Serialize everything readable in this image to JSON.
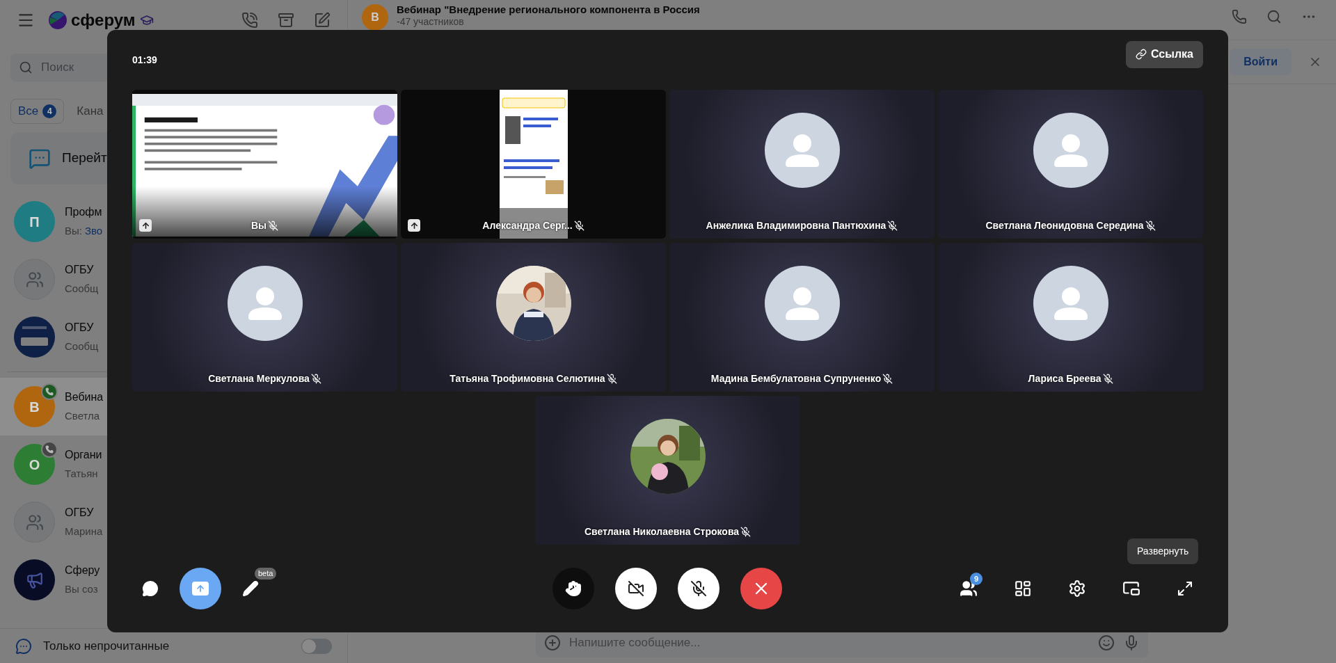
{
  "app_header": {
    "logo_text": "сферум"
  },
  "search": {
    "placeholder": "Поиск"
  },
  "filter_tabs": [
    {
      "label": "Все",
      "badge": "4",
      "selected": true
    },
    {
      "label": "Кана",
      "selected": false
    }
  ],
  "banner": {
    "text": "Перейт"
  },
  "chats": [
    {
      "title": "Профм",
      "preview": "Вы:",
      "link": "Зво",
      "avatar": {
        "kind": "letter",
        "letter": "П",
        "color": "#1f7c82"
      },
      "call_badge": false,
      "selected": false
    },
    {
      "title": "ОГБУ",
      "preview": "Сообщ",
      "avatar": {
        "kind": "group"
      },
      "call_badge": false,
      "selected": false
    },
    {
      "title": "ОГБУ",
      "preview": "Сообщ",
      "avatar": {
        "kind": "logo"
      },
      "call_badge": false,
      "selected": false
    },
    {
      "title": "Вебина",
      "preview": "Светла",
      "avatar": {
        "kind": "letter",
        "letter": "В",
        "color": "#b0650f"
      },
      "call_badge": true,
      "call_active": true,
      "selected": true
    },
    {
      "title": "Органи",
      "preview": "Татьян",
      "avatar": {
        "kind": "letter",
        "letter": "О",
        "color": "#2d7d35"
      },
      "call_badge": true,
      "call_active": false,
      "selected": false
    },
    {
      "title": "ОГБУ",
      "preview": "Марина",
      "avatar": {
        "kind": "group"
      },
      "call_badge": false,
      "selected": false
    },
    {
      "title": "Сферу",
      "preview": "Вы соз",
      "avatar": {
        "kind": "megaphone"
      },
      "call_badge": false,
      "selected": false
    }
  ],
  "unread_only": {
    "label": "Только непрочитанные",
    "on": false
  },
  "chat_header": {
    "avatar_letter": "В",
    "title": "Вебинар \"Внедрение регионального компонента в Россия",
    "subtitle": "-47 участников"
  },
  "join_bar": {
    "button": "Войти"
  },
  "composer": {
    "placeholder": "Напишите сообщение..."
  },
  "call": {
    "timer": "01:39",
    "link_button": "Ссылка",
    "tiles": [
      {
        "name": "Вы",
        "kind": "screen",
        "muted": true,
        "sharing": true
      },
      {
        "name": "Александра Серг...",
        "kind": "phone",
        "muted": true,
        "sharing": true
      },
      {
        "name": "Анжелика Владимировна Пантюхина",
        "kind": "avatar",
        "muted": true,
        "sharing": false
      },
      {
        "name": "Светлана Леонидовна Середина",
        "kind": "avatar",
        "muted": true,
        "sharing": false
      },
      {
        "name": "Светлана Меркулова",
        "kind": "avatar",
        "muted": true,
        "sharing": false
      },
      {
        "name": "Татьяна Трофимовна Селютина",
        "muted": true,
        "sharing": false
      },
      {
        "name": "Мадина Бембулатовна Супруненко",
        "kind": "avatar",
        "muted": true,
        "sharing": false
      },
      {
        "name": "Лариса Бреева",
        "kind": "avatar",
        "muted": true,
        "sharing": false
      },
      {
        "name": "Светлана Николаевна Строкова",
        "muted": true,
        "sharing": false
      }
    ],
    "toolbar": {
      "draw_badge": "beta",
      "participants_count": "9",
      "sharing_on": true,
      "camera_on": false,
      "mic_on": false
    },
    "tooltip": "Развернуть"
  }
}
